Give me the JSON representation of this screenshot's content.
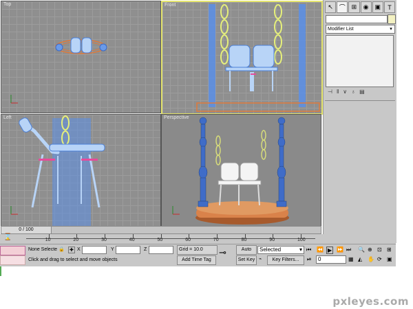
{
  "viewports": {
    "top": "Top",
    "front": "Front",
    "left": "Left",
    "perspective": "Perspective"
  },
  "command_panel": {
    "tabs": [
      "create-icon",
      "modify-icon",
      "hierarchy-icon",
      "motion-icon",
      "display-icon",
      "utilities-icon"
    ],
    "modifier_list": "Modifier List"
  },
  "timeline": {
    "slider": "0 / 100",
    "ticks": [
      "10",
      "20",
      "30",
      "40",
      "50",
      "60",
      "70",
      "80",
      "90",
      "100"
    ]
  },
  "status": {
    "selection": "None Selecte",
    "x_label": "X",
    "y_label": "Y",
    "z_label": "Z",
    "prompt": "Click and drag to select and move objects",
    "grid": "Grid = 10.0",
    "add_time_tag": "Add Time Tag",
    "auto_key": "Auto Key",
    "set_key": "Set Key",
    "key_mode": "Selected",
    "key_filters": "Key Filters...",
    "frame": "0"
  },
  "colors": {
    "accent_yellow": "#e6e66e",
    "viewport_gray": "#8f8f8f",
    "wireframe_blue": "#5b8fe8",
    "chain_yellow": "#e6f07a",
    "base_orange": "#d9824a"
  },
  "watermark": "pxleyes.com"
}
